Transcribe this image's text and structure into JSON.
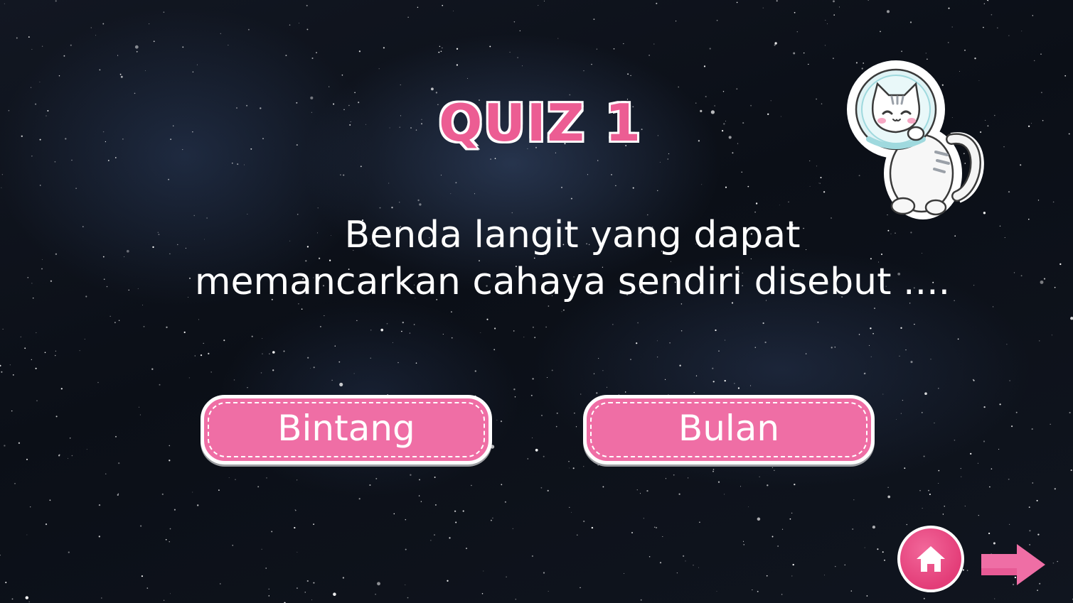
{
  "quiz": {
    "title": "QUIZ 1",
    "question_line1": "Benda langit yang dapat",
    "question_line2": "memancarkan cahaya sendiri disebut ....",
    "answers": [
      {
        "label": "Bintang"
      },
      {
        "label": "Bulan"
      }
    ]
  },
  "icons": {
    "mascot": "astronaut-cat-icon",
    "home": "home-icon",
    "next": "arrow-right-icon"
  },
  "colors": {
    "accent_pink": "#ef6ea5",
    "title_pink": "#ec5d93",
    "home_pink": "#e33d78",
    "background": "#0b0f17",
    "text": "#ffffff"
  }
}
